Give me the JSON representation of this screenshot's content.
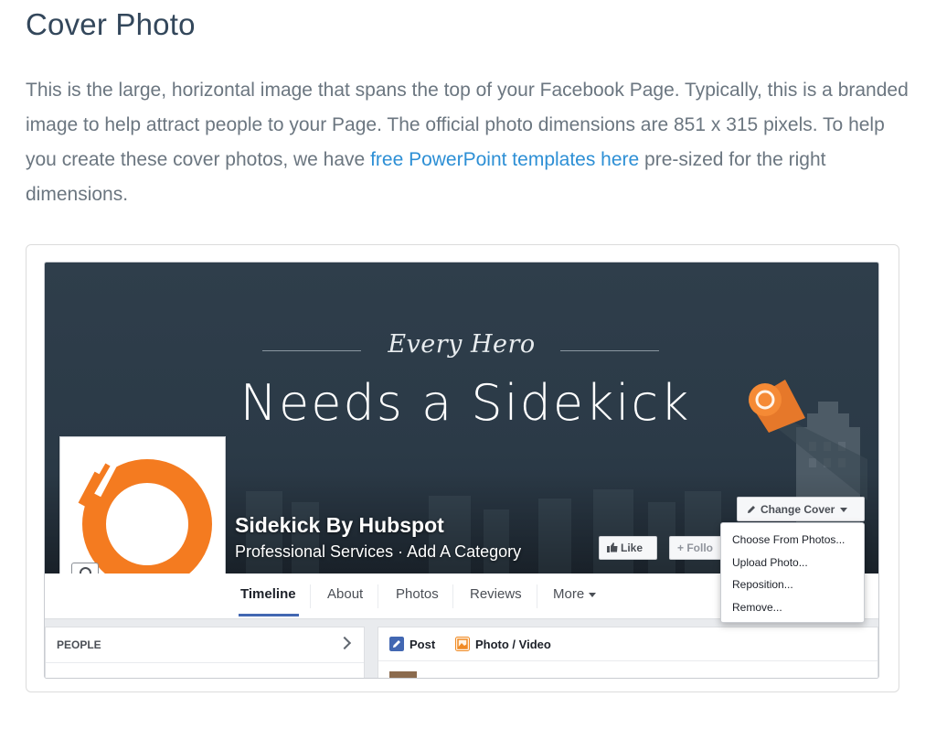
{
  "article": {
    "title": "Cover Photo",
    "intro_before_link": "This is the large, horizontal image that spans the top of your Facebook Page. Typically, this is a branded image to help attract people to your Page. The official photo dimensions are 851 x 315 pixels. To help you create these cover photos, we have ",
    "link_text": "free PowerPoint templates here",
    "intro_after_link": " pre-sized for the right dimensions.",
    "link_color": "#2d8fd5",
    "text_color": "#6b7680"
  },
  "facebook_page": {
    "cover": {
      "tagline": "Every Hero",
      "headline": "Needs a Sidekick"
    },
    "profile": {
      "logo_icon": "sidekick-logo-icon",
      "brand_color": "#f47b20",
      "camera_icon": "camera-icon"
    },
    "page_name": "Sidekick By Hubspot",
    "category": "Professional Services · Add A Category",
    "buttons": {
      "like": "Like",
      "follow": "+ Follo"
    },
    "change_cover": {
      "label": "Change Cover",
      "menu": [
        "Choose From Photos...",
        "Upload Photo...",
        "Reposition...",
        "Remove..."
      ]
    },
    "tabs": [
      "Timeline",
      "About",
      "Photos",
      "Reviews",
      "More"
    ],
    "active_tab": "Timeline",
    "people_section": {
      "title": "PEOPLE"
    },
    "composer": {
      "post": "Post",
      "photo_video": "Photo / Video"
    },
    "accent_color": "#4267b2"
  }
}
